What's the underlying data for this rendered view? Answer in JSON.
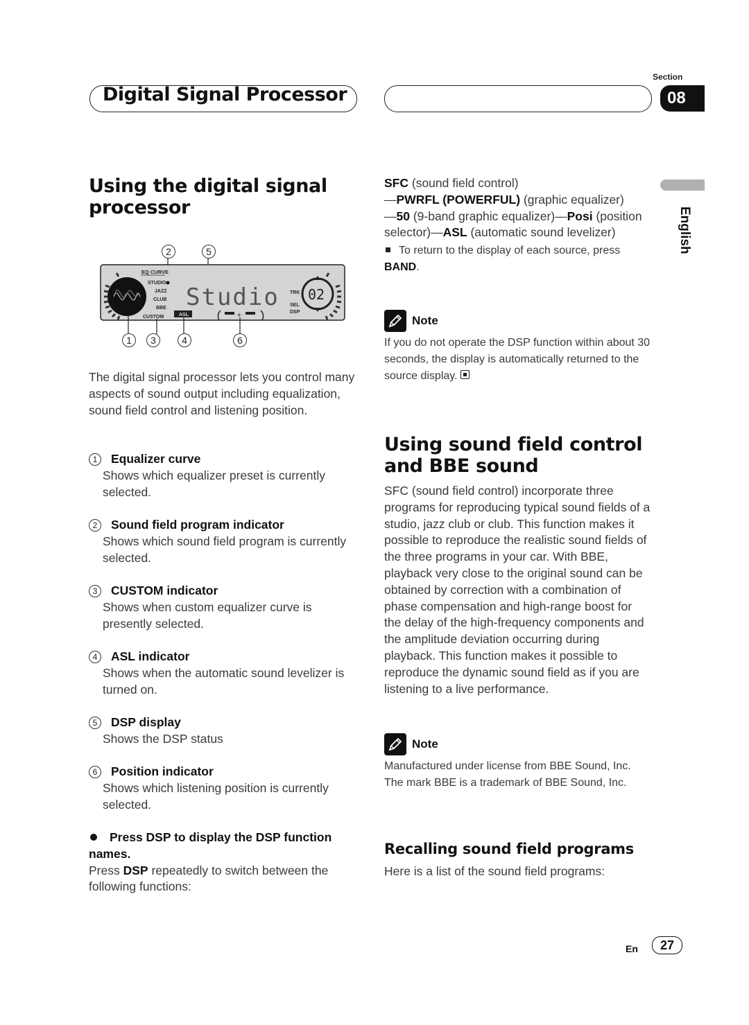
{
  "header": {
    "chapter_title": "Digital Signal Processor",
    "section_label": "Section",
    "section_number": "08",
    "language_tab": "English"
  },
  "left": {
    "title": "Using the digital signal processor",
    "title_line1": "Using the digital signal",
    "title_line2": "processor",
    "display": {
      "main_text": "Studio",
      "eq_curve_label": "EQ CURVE",
      "programs": [
        "STUDIO",
        "JAZZ",
        "CLUB",
        "BBE"
      ],
      "custom_label": "CUSTOM",
      "asl_label": "ASL",
      "trk_label": "TRK",
      "sel_label": "SEL",
      "dsp_label": "DSP",
      "track_number": "02",
      "callouts_top": [
        "2",
        "5"
      ],
      "callouts_bottom": [
        "1",
        "3",
        "4",
        "6"
      ]
    },
    "intro": "The digital signal processor lets you control many aspects of sound output including equalization, sound field control and listening position.",
    "items": [
      {
        "num": "1",
        "title": "Equalizer curve",
        "desc": "Shows which equalizer preset is currently selected."
      },
      {
        "num": "2",
        "title": "Sound field program indicator",
        "desc": "Shows which sound field program is currently selected."
      },
      {
        "num": "3",
        "title": "CUSTOM indicator",
        "desc": "Shows when custom equalizer curve is presently selected."
      },
      {
        "num": "4",
        "title": "ASL indicator",
        "desc": "Shows when the automatic sound levelizer is turned on."
      },
      {
        "num": "5",
        "title": "DSP display",
        "desc": "Shows the DSP status"
      },
      {
        "num": "6",
        "title": "Position indicator",
        "desc": "Shows which listening position is currently selected."
      }
    ],
    "step": {
      "bullet_title": "Press DSP to display the DSP function names.",
      "body_prefix": "Press ",
      "body_bold": "DSP",
      "body_suffix": " repeatedly to switch between the following functions:"
    }
  },
  "right": {
    "functions": {
      "sfc_bold": "SFC",
      "sfc_text": " (sound field control)",
      "pwrfl_bold": "PWRFL (POWERFUL)",
      "pwrfl_text": " (graphic equalizer)",
      "fifty_bold": "50",
      "fifty_text": " (9-band graphic equalizer)",
      "posi_bold": "Posi",
      "posi_text": " (position selector)",
      "asl_bold": "ASL",
      "asl_text": " (automatic sound levelizer)",
      "return_text": "To return to the display of each source, press ",
      "return_bold": "BAND",
      "return_end": "."
    },
    "note1": {
      "label": "Note",
      "text": "If you do not operate the DSP function within about 30 seconds, the display is automatically returned to the source display."
    },
    "sfc_section": {
      "title_line1": "Using sound field control",
      "title_line2": "and BBE sound",
      "body": "SFC (sound field control) incorporate three programs for reproducing typical sound fields of a studio, jazz club or club. This function makes it possible to reproduce the realistic sound fields of the three programs in your car. With BBE, playback very close to the original sound can be obtained by correction with a combination of phase compensation and high-range boost for the delay of the high-frequency components and the amplitude deviation occurring during playback. This function makes it possible to reproduce the dynamic sound field as if you are listening to a live performance."
    },
    "note2": {
      "label": "Note",
      "text": "Manufactured under license from BBE Sound, Inc. The mark BBE is a trademark of BBE Sound, Inc."
    },
    "recall": {
      "title": "Recalling sound field programs",
      "body": "Here is a list of the sound field programs:"
    }
  },
  "footer": {
    "lang_code": "En",
    "page_number": "27"
  }
}
